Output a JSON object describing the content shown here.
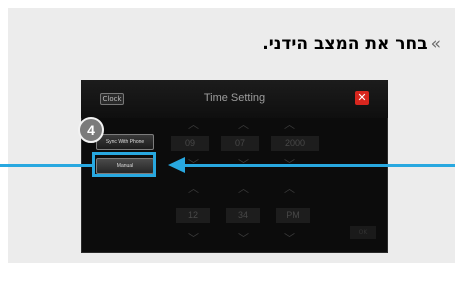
{
  "instruction": {
    "chevron": "»",
    "text": "בחר את המצב הידני."
  },
  "screen": {
    "clock_icon_label": "Clock",
    "title": "Time Setting",
    "close_label": "✕",
    "sync_button": "Sync With Phone",
    "manual_button": "Manual",
    "date": [
      "09",
      "07",
      "2000"
    ],
    "time": [
      "12",
      "34",
      "PM"
    ],
    "ok_label": "OK"
  },
  "annotation": {
    "step_number": "4"
  },
  "colors": {
    "highlight": "#28a8e0",
    "close": "#d7261e",
    "badge": "#7b7b7b"
  }
}
